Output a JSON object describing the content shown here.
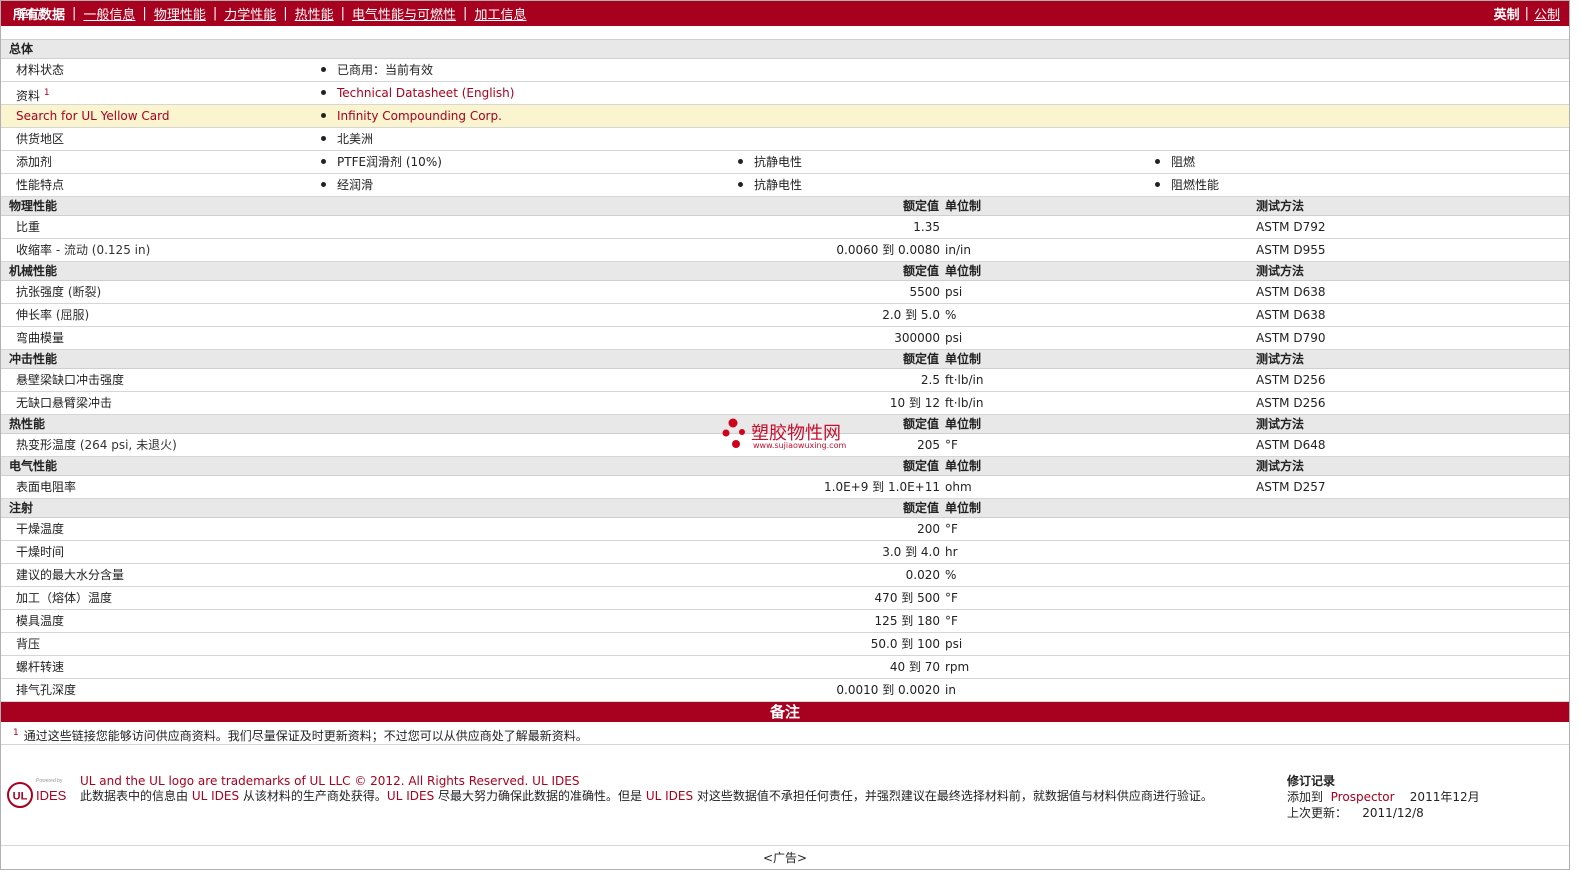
{
  "topbar": {
    "tabs": [
      "所有数据",
      "一般信息",
      "物理性能",
      "力学性能",
      "热性能",
      "电气性能与可燃性",
      "加工信息"
    ],
    "units_label": "单位",
    "unit_english": "英制",
    "unit_metric": "公制"
  },
  "general": {
    "title": "总体",
    "rows": [
      {
        "label": "材料状态",
        "cols": [
          "已商用：当前有效"
        ]
      },
      {
        "label": "资料",
        "sup": "1",
        "cols": [
          "Technical Datasheet (English)"
        ],
        "link": true
      },
      {
        "label": "Search for UL Yellow Card",
        "cols": [
          "Infinity Compounding Corp."
        ],
        "link": true,
        "highlight": true
      },
      {
        "label": "供货地区",
        "cols": [
          "北美洲"
        ]
      },
      {
        "label": "添加剂",
        "cols": [
          "PTFE润滑剂 (10%)",
          "抗静电性",
          "阻燃"
        ]
      },
      {
        "label": "性能特点",
        "cols": [
          "经润滑",
          "抗静电性",
          "阻燃性能"
        ]
      }
    ]
  },
  "headers": {
    "value": "额定值",
    "unit": "单位制",
    "test": "测试方法"
  },
  "sections": [
    {
      "title": "物理性能",
      "has_test": true,
      "rows": [
        {
          "label": "比重",
          "cond": "",
          "value": "1.35",
          "unit": "",
          "test": "ASTM D792"
        },
        {
          "label": "收缩率",
          "cond": " - 流动 (0.125 in)",
          "value": "0.0060 到  0.0080",
          "unit": "in/in",
          "test": "ASTM D955"
        }
      ]
    },
    {
      "title": "机械性能",
      "has_test": true,
      "rows": [
        {
          "label": "抗张强度",
          "cond": " (断裂)",
          "value": "5500",
          "unit": "psi",
          "test": "ASTM D638"
        },
        {
          "label": "伸长率",
          "cond": " (屈服)",
          "value": "2.0 到  5.0",
          "unit": "%",
          "test": "ASTM D638"
        },
        {
          "label": "弯曲模量",
          "cond": "",
          "value": "300000",
          "unit": "psi",
          "test": "ASTM D790"
        }
      ]
    },
    {
      "title": "冲击性能",
      "has_test": true,
      "rows": [
        {
          "label": "悬壁梁缺口冲击强度",
          "cond": "",
          "value": "2.5",
          "unit": "ft·lb/in",
          "test": "ASTM D256"
        },
        {
          "label": "无缺口悬臂梁冲击",
          "cond": "",
          "value": "10 到  12",
          "unit": "ft·lb/in",
          "test": "ASTM D256"
        }
      ]
    },
    {
      "title": "热性能",
      "has_test": true,
      "rows": [
        {
          "label": "热变形温度",
          "cond": " (264 psi, 未退火)",
          "value": "205",
          "unit": "°F",
          "test": "ASTM D648"
        }
      ]
    },
    {
      "title": "电气性能",
      "has_test": true,
      "rows": [
        {
          "label": "表面电阻率",
          "cond": "",
          "value": "1.0E+9 到  1.0E+11",
          "unit": "ohm",
          "test": "ASTM D257"
        }
      ]
    },
    {
      "title": "注射",
      "has_test": false,
      "rows": [
        {
          "label": "干燥温度",
          "cond": "",
          "value": "200",
          "unit": "°F",
          "test": ""
        },
        {
          "label": "干燥时间",
          "cond": "",
          "value": "3.0 到  4.0",
          "unit": "hr",
          "test": ""
        },
        {
          "label": "建议的最大水分含量",
          "cond": "",
          "value": "0.020",
          "unit": "%",
          "test": ""
        },
        {
          "label": "加工（熔体）温度",
          "cond": "",
          "value": "470 到  500",
          "unit": "°F",
          "test": ""
        },
        {
          "label": "模具温度",
          "cond": "",
          "value": "125 到  180",
          "unit": "°F",
          "test": ""
        },
        {
          "label": "背压",
          "cond": "",
          "value": "50.0 到  100",
          "unit": "psi",
          "test": ""
        },
        {
          "label": "螺杆转速",
          "cond": "",
          "value": "40 到  70",
          "unit": "rpm",
          "test": ""
        },
        {
          "label": "排气孔深度",
          "cond": "",
          "value": "0.0010 到  0.0020",
          "unit": "in",
          "test": ""
        }
      ]
    }
  ],
  "notes": {
    "title": "备注",
    "footnote_num": "1",
    "footnote": "通过这些链接您能够访问供应商资料。我们尽量保证及时更新资料；不过您可以从供应商处了解最新资料。"
  },
  "footer": {
    "logo_powered": "Powered by",
    "logo_ul": "UL",
    "logo_ides": "IDES",
    "line1": "UL and the UL logo are trademarks of UL LLC © 2012. All Rights Reserved. UL IDES",
    "line2_a": "此数据表中的信息由 ",
    "line2_b": "UL IDES",
    "line2_c": " 从该材料的生产商处获得。",
    "line2_d": "UL IDES",
    "line2_e": " 尽最大努力确保此数据的准确性。但是 ",
    "line2_f": "UL IDES",
    "line2_g": " 对这些数据值不承担任何责任，并强烈建议在最终选择材料前，就数据值与材料供应商进行验证。",
    "rev_title": "修订记录",
    "rev_added_label": "添加到",
    "rev_added_by": "Prospector",
    "rev_added_date": "2011年12月",
    "rev_updated_label": "上次更新：",
    "rev_updated_date": "2011/12/8"
  },
  "watermark": {
    "title": "塑胶物性网",
    "url": "www.sujiaowuxing.com"
  },
  "ad": "<广告>",
  "colors": {
    "brand_red": "#a8001f",
    "section_bg": "#e8e8e8",
    "highlight_bg": "#fbf5cf"
  }
}
